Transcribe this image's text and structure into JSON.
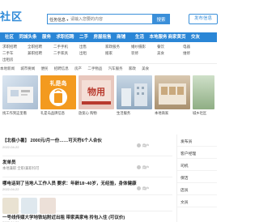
{
  "header": {
    "logo": "社区",
    "search_category": "任务信息",
    "search_placeholder": "请输入您要的内容",
    "search_button": "搜索",
    "publish_button": "发布信息"
  },
  "nav": [
    "社区",
    "同城头条",
    "服务",
    "求职招聘",
    "二手",
    "房屋租售",
    "商铺",
    "生活",
    "本地服务",
    "商家黄页",
    "交友"
  ],
  "subnav": {
    "col1": [
      "求职招聘",
      "二手车",
      "出租房"
    ],
    "col2": [
      "全职招聘",
      "兼职招聘"
    ],
    "col3": [
      "二手手机",
      "二手家具"
    ],
    "col4": [
      "出售",
      "出租"
    ],
    "col5": [
      "家政服务",
      "搬家"
    ],
    "col6": [
      "婚纱摄影",
      "装修"
    ],
    "col7": [
      "餐饮",
      "美食"
    ],
    "col8": [
      "电器",
      "维修"
    ]
  },
  "tags": [
    "本地新闻",
    "城市要闻",
    "便民",
    "招聘信息",
    "房产",
    "二手物品",
    "汽车服务",
    "家政",
    "美食"
  ],
  "cards": [
    {
      "caption": "找工作到这里看"
    },
    {
      "caption": "礼是岛品牌信息"
    },
    {
      "caption": "放宽心 购物"
    },
    {
      "caption": "生活服务"
    },
    {
      "caption": "本地商家"
    },
    {
      "caption": "城乡社区"
    }
  ],
  "listing": [
    {
      "title": "【北极小暑】 2000元/月一份……可天符6个人合伙",
      "sub": "",
      "meta": "2022-04-22",
      "author": "用户"
    },
    {
      "title": "发单员",
      "sub": "本地兼职 全职/兼职均可",
      "meta": "本地兼职",
      "author": "用户"
    },
    {
      "title": "哪电话到了当地人工作人员 要求：年龄18~40岁，无经验，身体健康",
      "sub": "",
      "meta": "2022-04-22",
      "author": "用户"
    },
    {
      "title": "",
      "sub": "",
      "meta": "",
      "author": ""
    },
    {
      "title": "一号线传媒大学地铁站附近出租 带家具家电 拎包入住 (可议价)",
      "sub": "",
      "meta": "2022-04-20",
      "author": "用户"
    }
  ],
  "sidebar": [
    {
      "label": "发布员",
      "sub": ""
    },
    {
      "label": "客户经理",
      "sub": ""
    },
    {
      "label": "司机",
      "sub": ""
    },
    {
      "label": "保洁",
      "sub": ""
    },
    {
      "label": "店员",
      "sub": ""
    },
    {
      "label": "文员",
      "sub": ""
    }
  ],
  "colors": {
    "brand": "#2a86d6",
    "search_border": "#3a8fd9"
  }
}
